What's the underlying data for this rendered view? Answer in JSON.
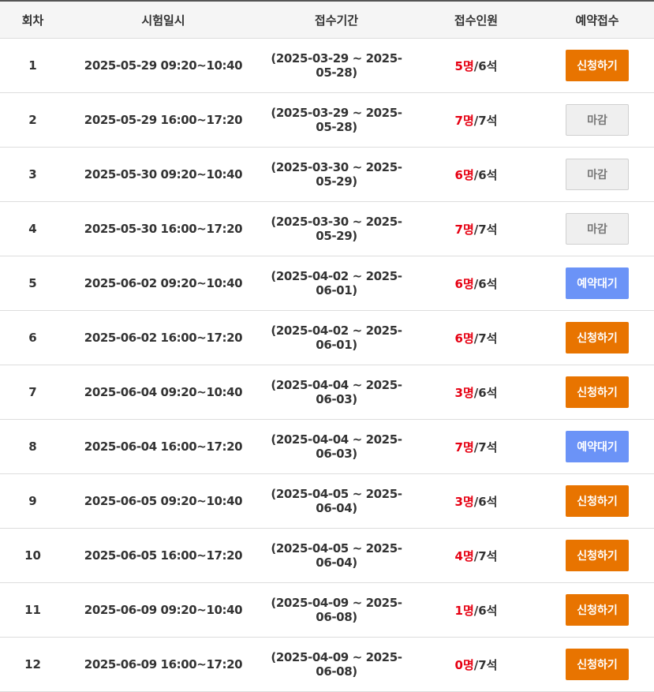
{
  "header": {
    "round": "회차",
    "exam_datetime": "시험일시",
    "reception_period": "접수기간",
    "applicants": "접수인원",
    "reservation": "예약접수"
  },
  "colors": {
    "apply": "#e87400",
    "closed": "#efefef",
    "wait": "#6b93f7",
    "count": "#e60012"
  },
  "rows": [
    {
      "round": "1",
      "datetime": "2025-05-29 09:20~10:40",
      "period": "(2025-03-29 ~ 2025-05-28)",
      "count": "5명",
      "seats": "/6석",
      "button": "신청하기",
      "status": "apply"
    },
    {
      "round": "2",
      "datetime": "2025-05-29 16:00~17:20",
      "period": "(2025-03-29 ~ 2025-05-28)",
      "count": "7명",
      "seats": "/7석",
      "button": "마감",
      "status": "closed"
    },
    {
      "round": "3",
      "datetime": "2025-05-30 09:20~10:40",
      "period": "(2025-03-30 ~ 2025-05-29)",
      "count": "6명",
      "seats": "/6석",
      "button": "마감",
      "status": "closed"
    },
    {
      "round": "4",
      "datetime": "2025-05-30 16:00~17:20",
      "period": "(2025-03-30 ~ 2025-05-29)",
      "count": "7명",
      "seats": "/7석",
      "button": "마감",
      "status": "closed"
    },
    {
      "round": "5",
      "datetime": "2025-06-02 09:20~10:40",
      "period": "(2025-04-02 ~ 2025-06-01)",
      "count": "6명",
      "seats": "/6석",
      "button": "예약대기",
      "status": "wait"
    },
    {
      "round": "6",
      "datetime": "2025-06-02 16:00~17:20",
      "period": "(2025-04-02 ~ 2025-06-01)",
      "count": "6명",
      "seats": "/7석",
      "button": "신청하기",
      "status": "apply"
    },
    {
      "round": "7",
      "datetime": "2025-06-04 09:20~10:40",
      "period": "(2025-04-04 ~ 2025-06-03)",
      "count": "3명",
      "seats": "/6석",
      "button": "신청하기",
      "status": "apply"
    },
    {
      "round": "8",
      "datetime": "2025-06-04 16:00~17:20",
      "period": "(2025-04-04 ~ 2025-06-03)",
      "count": "7명",
      "seats": "/7석",
      "button": "예약대기",
      "status": "wait"
    },
    {
      "round": "9",
      "datetime": "2025-06-05 09:20~10:40",
      "period": "(2025-04-05 ~ 2025-06-04)",
      "count": "3명",
      "seats": "/6석",
      "button": "신청하기",
      "status": "apply"
    },
    {
      "round": "10",
      "datetime": "2025-06-05 16:00~17:20",
      "period": "(2025-04-05 ~ 2025-06-04)",
      "count": "4명",
      "seats": "/7석",
      "button": "신청하기",
      "status": "apply"
    },
    {
      "round": "11",
      "datetime": "2025-06-09 09:20~10:40",
      "period": "(2025-04-09 ~ 2025-06-08)",
      "count": "1명",
      "seats": "/6석",
      "button": "신청하기",
      "status": "apply"
    },
    {
      "round": "12",
      "datetime": "2025-06-09 16:00~17:20",
      "period": "(2025-04-09 ~ 2025-06-08)",
      "count": "0명",
      "seats": "/7석",
      "button": "신청하기",
      "status": "apply"
    }
  ]
}
